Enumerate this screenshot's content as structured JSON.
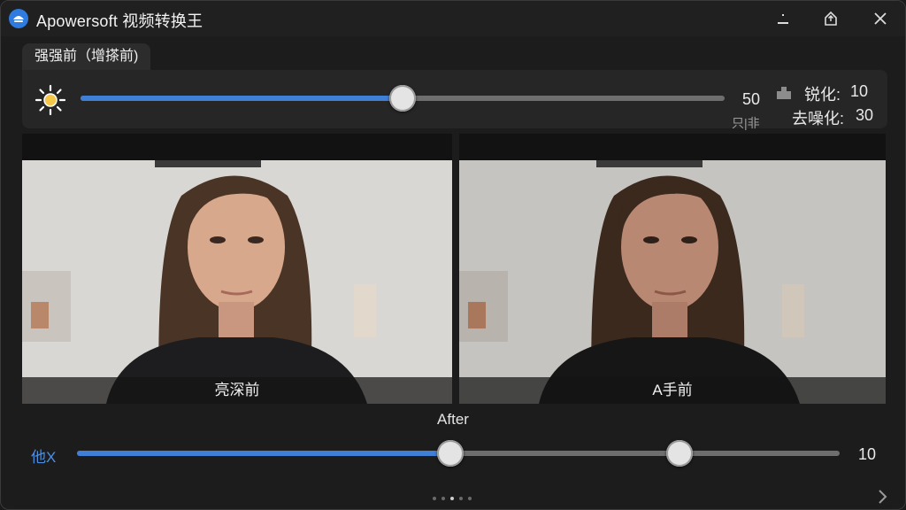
{
  "app": {
    "title": "Apowersoft 视频转换王"
  },
  "tab": {
    "label": "强强前（增搽前)"
  },
  "brightness": {
    "value_text": "50",
    "level_percent": 50,
    "sub_label": "只|非"
  },
  "sharpen": {
    "label": "锐化:",
    "value": "10"
  },
  "denoise": {
    "label": "去噪化:",
    "value": "30"
  },
  "before_panel": {
    "caption": "亮深前"
  },
  "after_panel": {
    "caption": "A手前"
  },
  "after_label": "After",
  "bottom_slider": {
    "label": "他X",
    "value_text": "10",
    "thumb1_percent": 49,
    "thumb2_percent": 79
  },
  "pagination": {
    "count": 5,
    "active_index": 2
  },
  "colors": {
    "accent": "#3f7fd6",
    "window": "#1c1c1c",
    "panel": "#262626"
  },
  "icons": {
    "logo": "apowersoft-logo-icon",
    "minimize": "minimize-icon",
    "pin": "pin-icon",
    "close": "close-icon",
    "sun": "sun-icon",
    "sharpen": "sharpen-icon",
    "next": "chevron-right-icon"
  }
}
